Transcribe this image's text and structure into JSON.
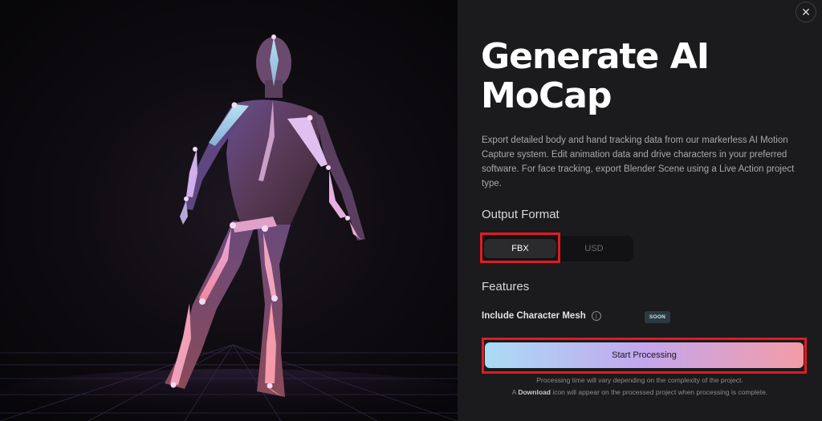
{
  "panel": {
    "close_symbol": "✕",
    "title_line1": "Generate AI",
    "title_line2": "MoCap",
    "description": "Export detailed body and hand tracking data from our markerless AI Motion Capture system. Edit animation data and drive characters in your preferred software. For face tracking, export Blender Scene using a Live Action project type.",
    "output_format_label": "Output Format",
    "formats": [
      {
        "label": "FBX",
        "selected": true
      },
      {
        "label": "USD",
        "selected": false
      }
    ],
    "features_label": "Features",
    "feature_name": "Include Character Mesh",
    "info_symbol": "i",
    "soon_badge": "SOON",
    "start_button": "Start Processing",
    "note_line1": "Processing time will vary depending on the complexity of the project.",
    "note_line2_prefix": "A ",
    "note_line2_bold": "Download",
    "note_line2_suffix": " icon will appear on the processed project when processing is complete."
  },
  "colors": {
    "panel_bg": "#1b1b1d",
    "highlight": "#e01b23",
    "button_gradient_start": "#a9dcf5",
    "button_gradient_mid": "#c4a6ee",
    "button_gradient_end": "#f39ca6",
    "soon_badge_bg": "#2a3a40"
  },
  "icons": {
    "close": "close-icon",
    "info": "info-icon",
    "figure": "mocap-skeleton-figure"
  }
}
